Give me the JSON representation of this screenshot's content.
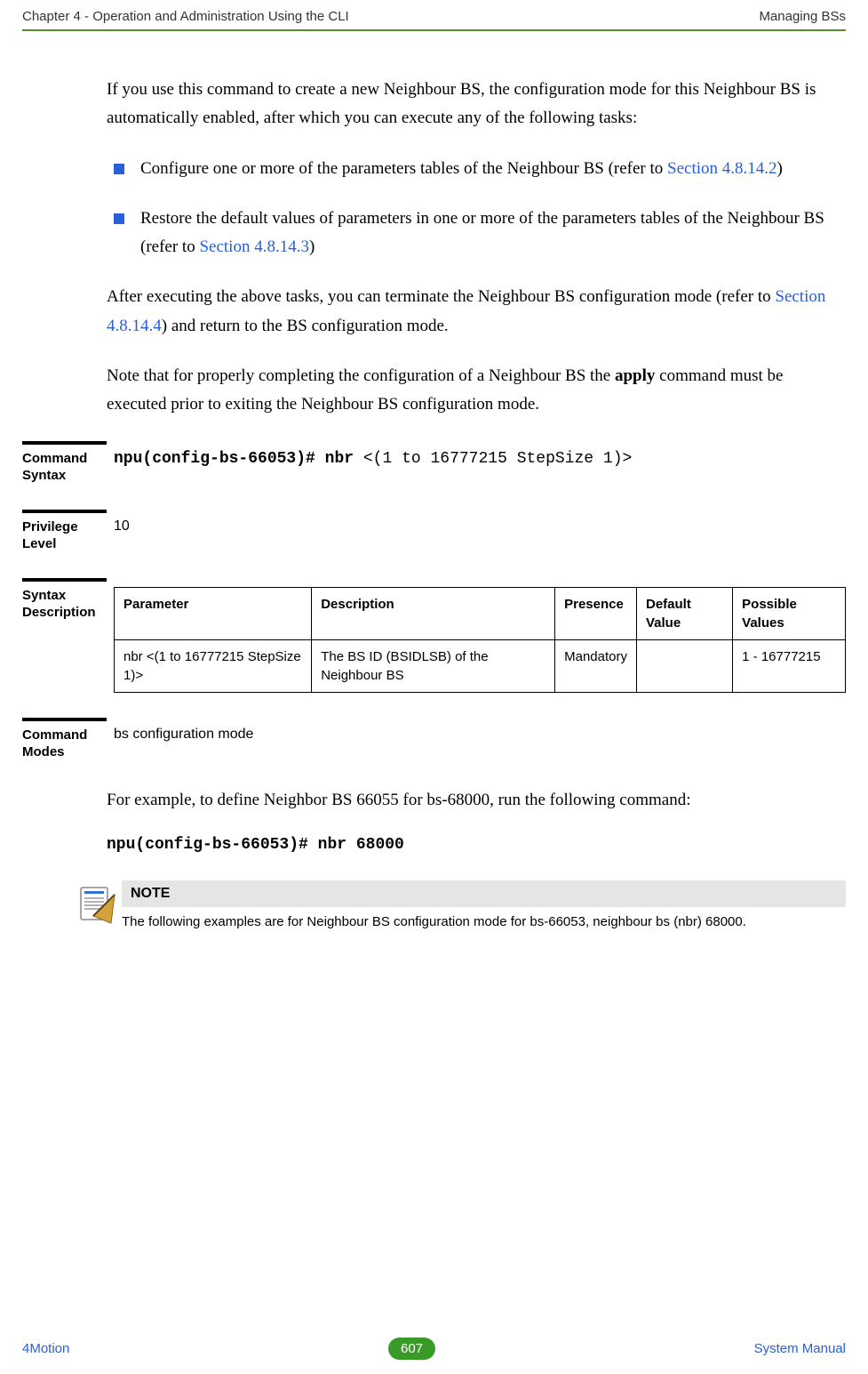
{
  "header": {
    "left": "Chapter 4 - Operation and Administration Using the CLI",
    "right": "Managing BSs"
  },
  "body": {
    "intro": "If you use this command to create a new Neighbour BS, the configuration mode for this Neighbour BS is automatically enabled, after which you can execute any of the following tasks:",
    "bullets": [
      {
        "text_before": "Configure one or more of the parameters tables of the Neighbour BS (refer to ",
        "link": "Section 4.8.14.2",
        "text_after": ")"
      },
      {
        "text_before": "Restore the default values of parameters in one or more of the parameters tables of the Neighbour BS (refer to ",
        "link": "Section 4.8.14.3",
        "text_after": ")"
      }
    ],
    "after_exec_pre": "After executing the above tasks, you can terminate the Neighbour BS configuration mode (refer to ",
    "after_exec_link": "Section 4.8.14.4",
    "after_exec_post": ") and return to the BS configuration mode.",
    "note_proper_pre": "Note that for properly completing the configuration of a Neighbour BS the ",
    "note_proper_bold": "apply",
    "note_proper_post": " command must be executed prior to exiting the Neighbour BS configuration mode."
  },
  "sections": {
    "command_syntax_label": "Command Syntax",
    "command_syntax": {
      "bold": "npu(config-bs-66053)# nbr ",
      "rest": "<(1 to 16777215 StepSize 1)>"
    },
    "privilege_label": "Privilege Level",
    "privilege_value": "10",
    "syntax_desc_label": "Syntax Description",
    "table": {
      "headers": [
        "Parameter",
        "Description",
        "Presence",
        "Default Value",
        "Possible Values"
      ],
      "row": {
        "parameter": "nbr <(1 to 16777215 StepSize 1)>",
        "description": "The BS ID (BSIDLSB) of the Neighbour BS",
        "presence": "Mandatory",
        "default": "",
        "possible": "1 - 16777215"
      }
    },
    "command_modes_label": "Command Modes",
    "command_modes_value": "bs configuration mode"
  },
  "example": {
    "intro": "For example, to define Neighbor BS 66055 for bs-68000, run the following command:",
    "cmd": "npu(config-bs-66053)# nbr 68000"
  },
  "note": {
    "title": "NOTE",
    "text": "The following examples are for Neighbour BS configuration mode for bs-66053,  neighbour bs (nbr) 68000."
  },
  "footer": {
    "left": "4Motion",
    "page": "607",
    "right": "System Manual"
  }
}
